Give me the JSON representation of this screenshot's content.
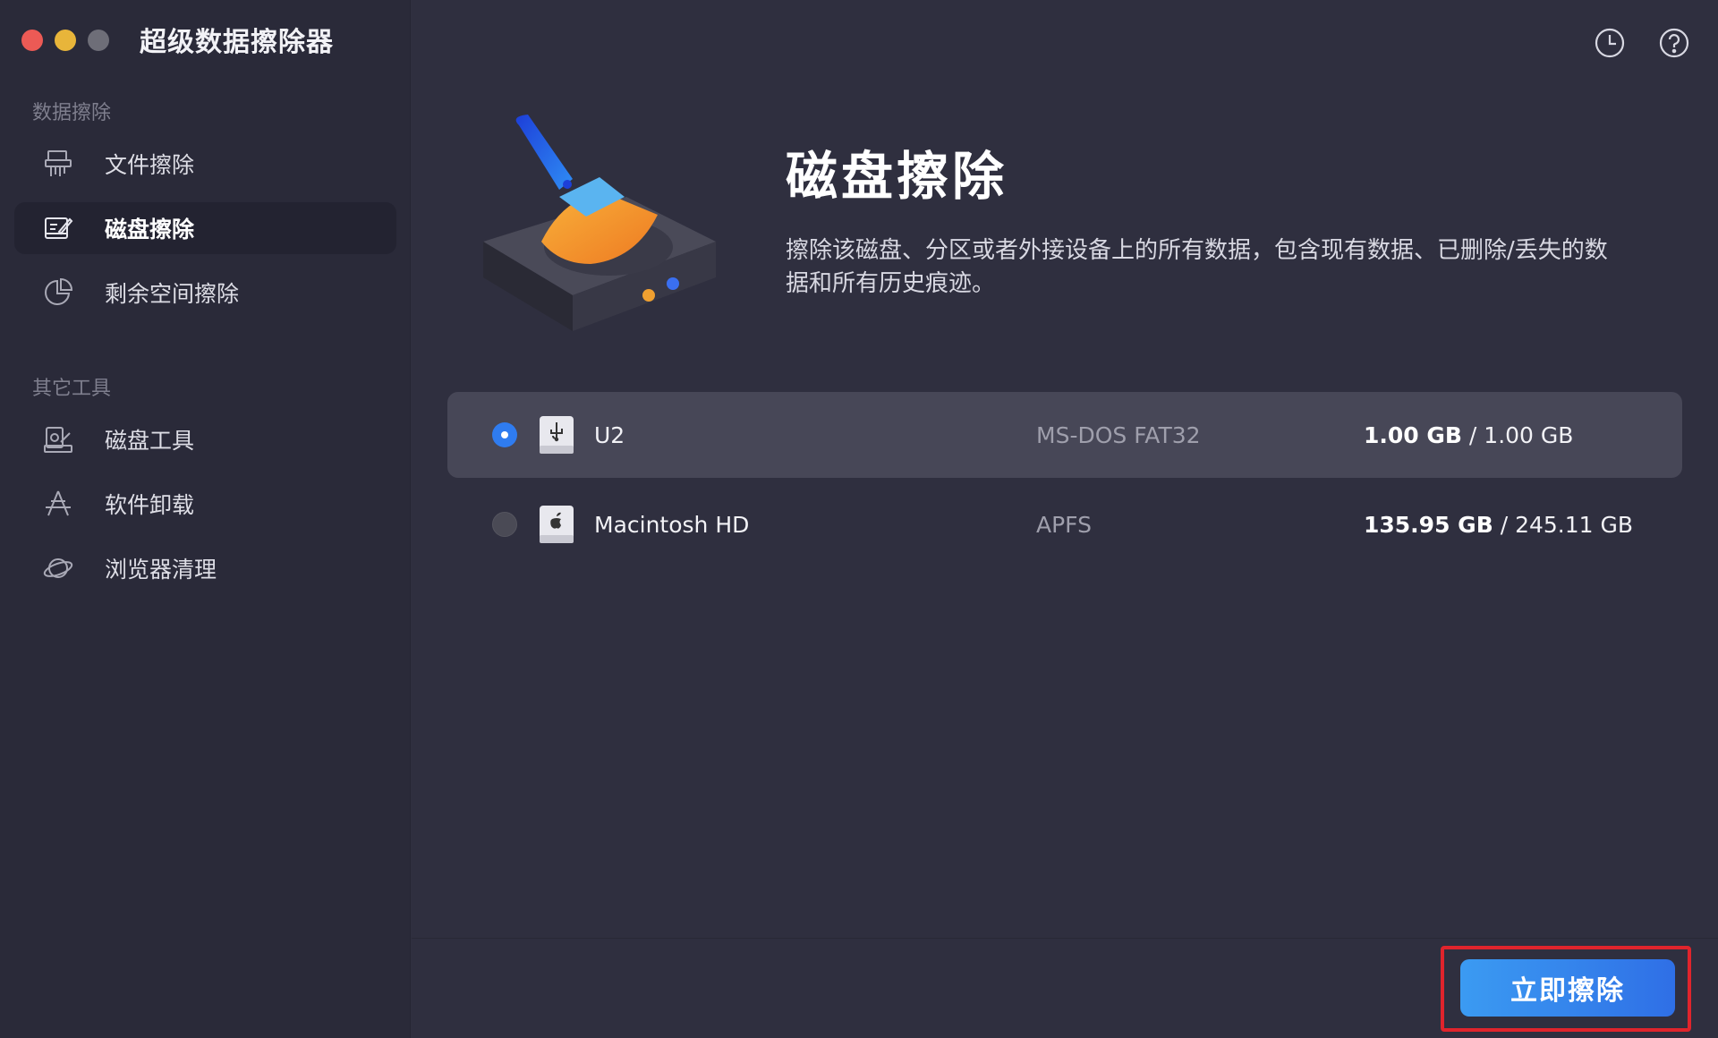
{
  "app": {
    "title": "超级数据擦除器"
  },
  "sidebar": {
    "sections": [
      {
        "label": "数据擦除",
        "items": [
          {
            "label": "文件擦除",
            "icon": "shredder-icon"
          },
          {
            "label": "磁盘擦除",
            "icon": "disk-erase-icon",
            "active": true
          },
          {
            "label": "剩余空间擦除",
            "icon": "pie-chart-icon"
          }
        ]
      },
      {
        "label": "其它工具",
        "items": [
          {
            "label": "磁盘工具",
            "icon": "disk-tool-icon"
          },
          {
            "label": "软件卸载",
            "icon": "app-store-icon"
          },
          {
            "label": "浏览器清理",
            "icon": "planet-icon"
          }
        ]
      }
    ]
  },
  "header": {
    "icons": [
      "history-clock-icon",
      "help-icon"
    ]
  },
  "hero": {
    "title": "磁盘擦除",
    "description": "擦除该磁盘、分区或者外接设备上的所有数据，包含现有数据、已删除/丢失的数据和所有历史痕迹。"
  },
  "disks": [
    {
      "name": "U2",
      "filesystem": "MS-DOS FAT32",
      "used": "1.00 GB",
      "total": "/ 1.00 GB",
      "selected": true,
      "icon": "usb-drive-icon"
    },
    {
      "name": "Macintosh HD",
      "filesystem": "APFS",
      "used": "135.95 GB",
      "total": "/ 245.11 GB",
      "selected": false,
      "icon": "mac-drive-icon"
    }
  ],
  "actions": {
    "erase_label": "立即擦除"
  },
  "colors": {
    "accent": "#2f7cf0",
    "highlight": "#e0242c"
  }
}
